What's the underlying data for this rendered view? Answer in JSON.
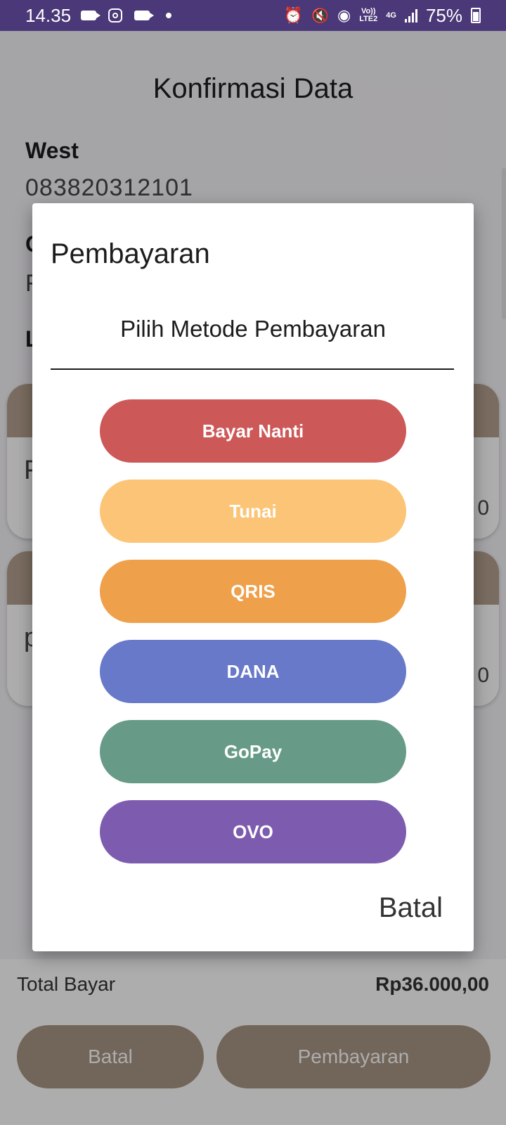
{
  "status_bar": {
    "time": "14.35",
    "volte": "Vo))",
    "lte": "LTE2",
    "network": "4G",
    "battery": "75%"
  },
  "page": {
    "title": "Konfirmasi Data",
    "customer_name": "West",
    "customer_phone": "083820312101",
    "partial_label_1": "C",
    "partial_value_1": "F",
    "partial_label_2": "L",
    "card1_letter": "F",
    "card1_price_fragment": "0",
    "card2_letter": "p",
    "card2_price_fragment": "0",
    "total_label": "Total Bayar",
    "total_value": "Rp36.000,00",
    "cancel_button": "Batal",
    "pay_button": "Pembayaran"
  },
  "dialog": {
    "title": "Pembayaran",
    "subtitle": "Pilih Metode Pembayaran",
    "methods": [
      {
        "label": "Bayar Nanti",
        "color": "#cd5858"
      },
      {
        "label": "Tunai",
        "color": "#fcc476"
      },
      {
        "label": "QRIS",
        "color": "#efa04b"
      },
      {
        "label": "DANA",
        "color": "#6779c8"
      },
      {
        "label": "GoPay",
        "color": "#679b88"
      },
      {
        "label": "OVO",
        "color": "#7d5caf"
      }
    ],
    "cancel_label": "Batal"
  },
  "colors": {
    "status_bar": "#4a3878",
    "card_header": "#b4a08e",
    "bottom_button": "#a89684"
  }
}
